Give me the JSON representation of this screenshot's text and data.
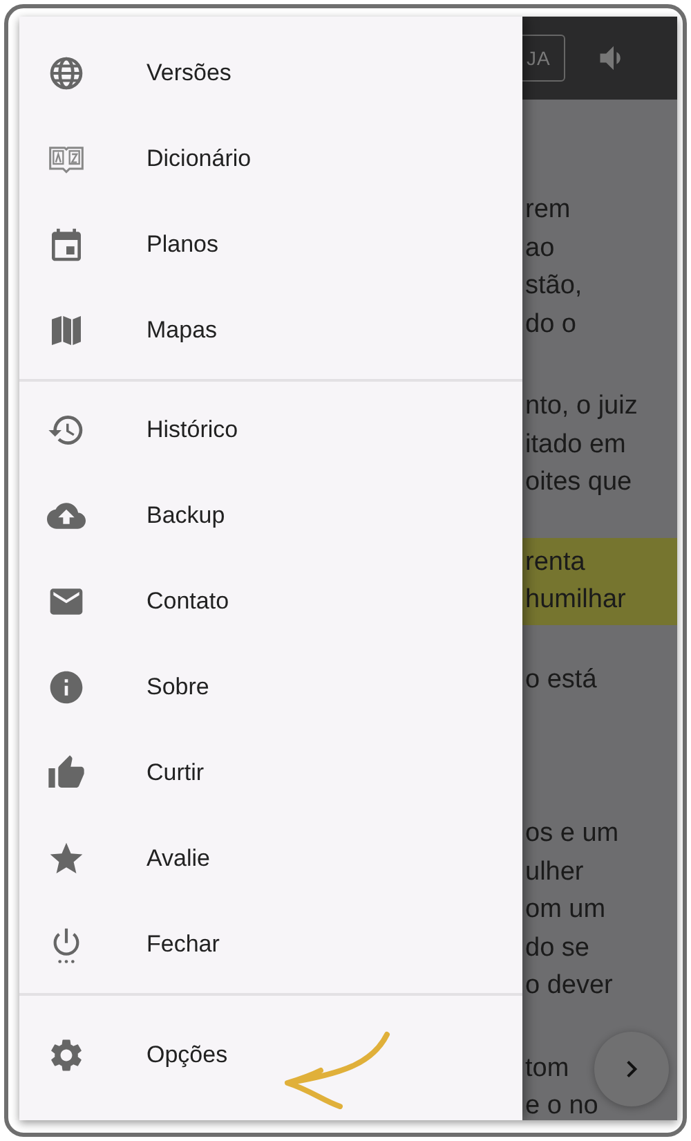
{
  "drawer": {
    "sections": [
      {
        "items": [
          {
            "label": "Versões"
          },
          {
            "label": "Dicionário"
          },
          {
            "label": "Planos"
          },
          {
            "label": "Mapas"
          }
        ]
      },
      {
        "items": [
          {
            "label": "Histórico"
          },
          {
            "label": "Backup"
          },
          {
            "label": "Contato"
          },
          {
            "label": "Sobre"
          },
          {
            "label": "Curtir"
          },
          {
            "label": "Avalie"
          },
          {
            "label": "Fechar"
          }
        ]
      },
      {
        "items": [
          {
            "label": "Opções"
          }
        ]
      }
    ]
  },
  "reader": {
    "toolbar_button": "JA",
    "paragraphs": [
      {
        "lines": [
          "rem",
          "ao",
          "stão,",
          "do o"
        ]
      },
      {
        "lines": [
          "nto, o juiz",
          "itado em",
          "oites que"
        ]
      },
      {
        "highlighted": true,
        "lines": [
          "renta",
          "humilhar"
        ]
      },
      {
        "lines": [
          "o está"
        ]
      },
      {
        "lines": [
          "os e um",
          "ulher",
          "om um",
          "do se",
          "o dever"
        ]
      },
      {
        "lines": [
          "tom",
          "e o no"
        ]
      }
    ]
  }
}
